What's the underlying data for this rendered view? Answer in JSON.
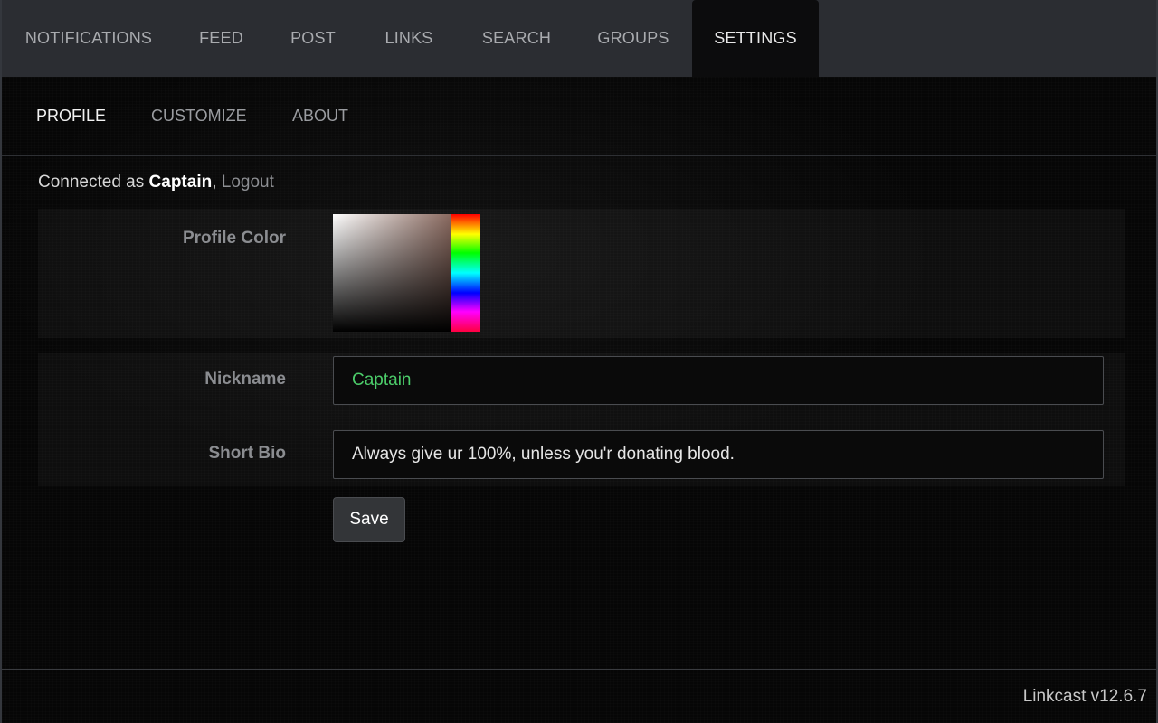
{
  "top_nav": {
    "tabs": [
      {
        "label": "NOTIFICATIONS"
      },
      {
        "label": "FEED"
      },
      {
        "label": "POST"
      },
      {
        "label": "LINKS"
      },
      {
        "label": "SEARCH"
      },
      {
        "label": "GROUPS"
      },
      {
        "label": "SETTINGS",
        "active": true
      }
    ]
  },
  "sub_nav": {
    "tabs": [
      {
        "label": "PROFILE",
        "active": true
      },
      {
        "label": "CUSTOMIZE"
      },
      {
        "label": "ABOUT"
      }
    ]
  },
  "session": {
    "prefix": "Connected as ",
    "username": "Captain",
    "separator": ", ",
    "logout_label": "Logout"
  },
  "profile_form": {
    "color_label": "Profile Color",
    "nickname_label": "Nickname",
    "nickname_value": "Captain",
    "nickname_color": "#4ccd6a",
    "bio_label": "Short Bio",
    "bio_value": "Always give ur 100%, unless you'r donating blood.",
    "save_label": "Save"
  },
  "footer": {
    "version": "Linkcast v12.6.7"
  }
}
